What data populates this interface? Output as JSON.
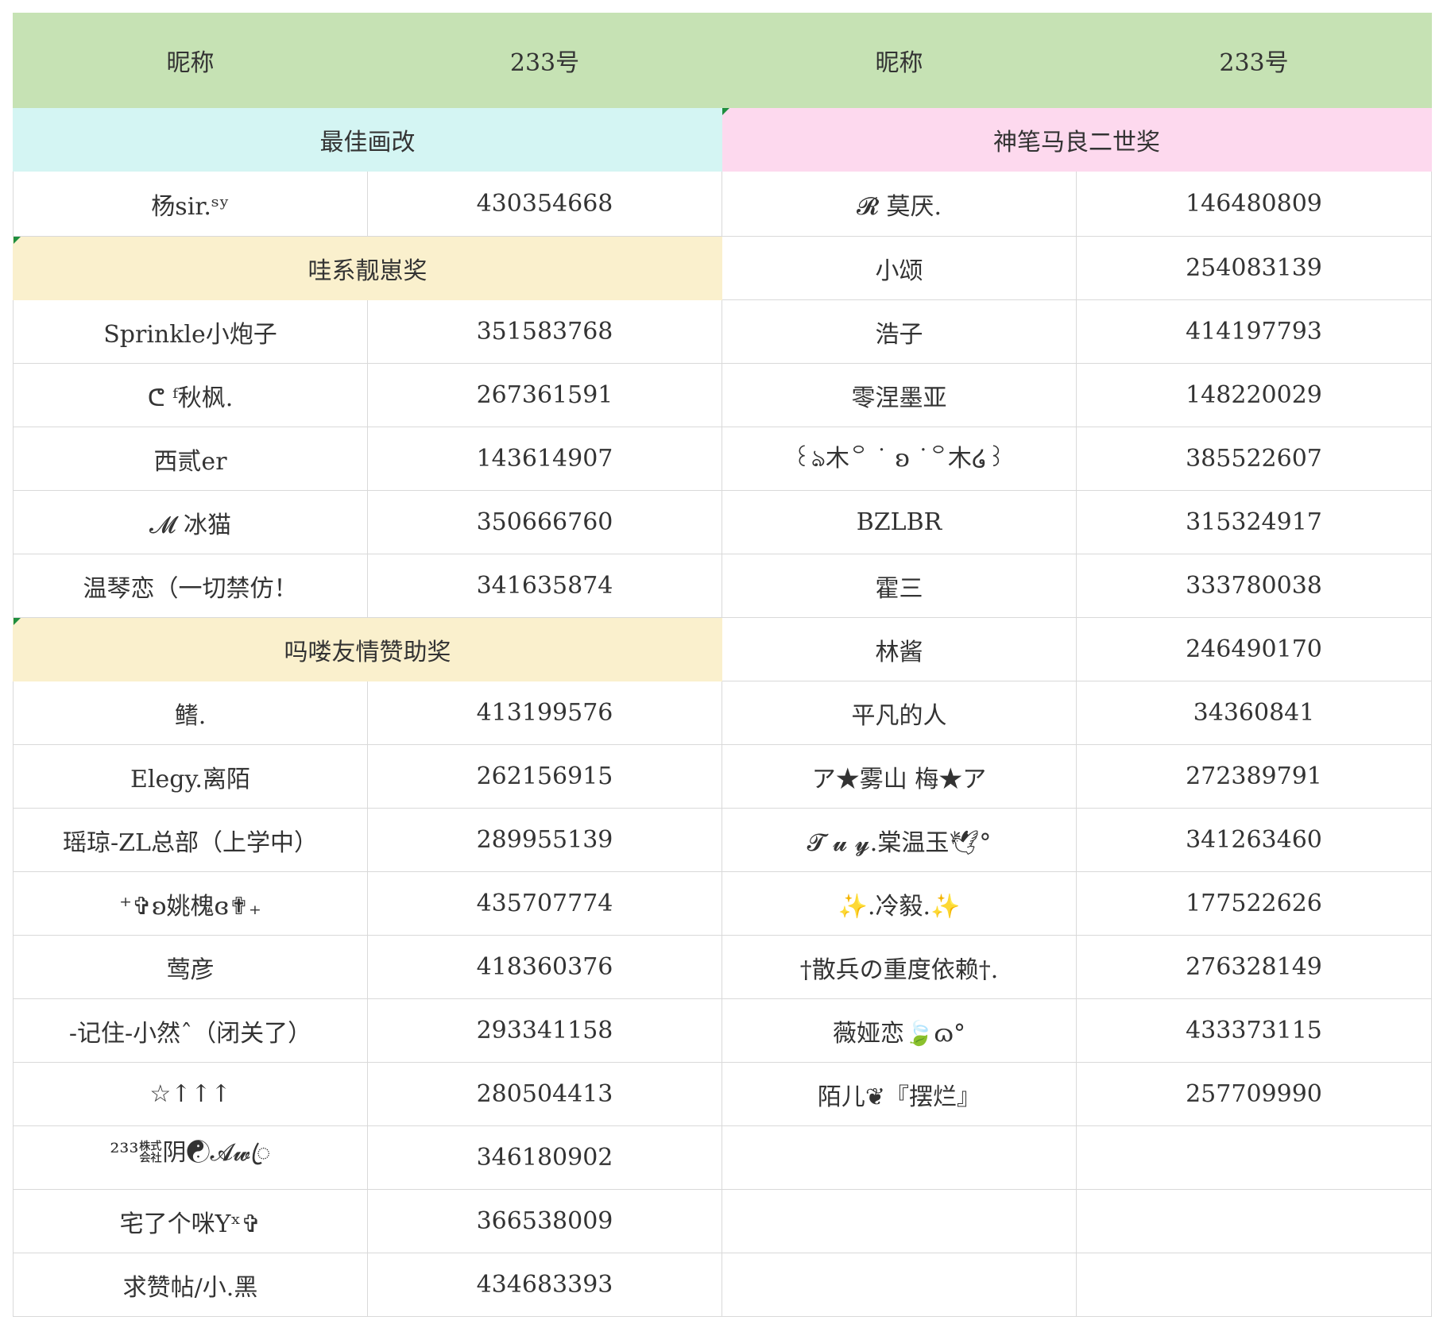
{
  "headers": [
    "昵称",
    "233号",
    "昵称",
    "233号"
  ],
  "awards": {
    "best_redraw": "最佳画改",
    "shenbi": "神笔马良二世奖",
    "wah_cute": "哇系靓崽奖",
    "malou_friendship": "吗喽友情赞助奖"
  },
  "left": [
    {
      "name": "杨sir.ˢʸ",
      "id": "430354668"
    },
    {
      "name": "Sprinkle小炮子",
      "id": "351583768"
    },
    {
      "name": "ᕦ ᶠ秋枫.",
      "id": "267361591"
    },
    {
      "name": "西贰er",
      "id": "143614907"
    },
    {
      "name": "𝓜 冰猫",
      "id": "350666760"
    },
    {
      "name": "温琴恋（一切禁仿！",
      "id": "341635874"
    },
    {
      "name": "鳍.",
      "id": "413199576"
    },
    {
      "name": "Elegy.离陌",
      "id": "262156915"
    },
    {
      "name": "瑶琼-ZL总部（上学中）",
      "id": "289955139"
    },
    {
      "name": "⁺✞ʚ姚槐ɞ✟₊",
      "id": "435707774"
    },
    {
      "name": "莺彦",
      "id": "418360376"
    },
    {
      "name": "-记住-小然ˆ（闭关了）",
      "id": "293341158"
    },
    {
      "name": "☆↑↑↑",
      "id": "280504413"
    },
    {
      "name": "²³³㍿阴☯𝓐𝔀ꦿ",
      "id": "346180902"
    },
    {
      "name": "宅了个咪Yˣ✞",
      "id": "366538009"
    },
    {
      "name": "求赞帖/小.黑",
      "id": "434683393"
    }
  ],
  "right": [
    {
      "name": "𝓡 莫厌.",
      "id": "146480809"
    },
    {
      "name": "小颂",
      "id": "254083139"
    },
    {
      "name": "浩子",
      "id": "414197793"
    },
    {
      "name": "零涅墨亚",
      "id": "148220029"
    },
    {
      "name": "꒰ঌ木꒪ ˙ ʚ ˙꒪木໒꒱",
      "id": "385522607"
    },
    {
      "name": "BZLBR",
      "id": "315324917"
    },
    {
      "name": "霍三",
      "id": "333780038"
    },
    {
      "name": "林酱",
      "id": "246490170"
    },
    {
      "name": "平凡的人",
      "id": "34360841"
    },
    {
      "name": "ア★雾山 梅★ア",
      "id": "272389791"
    },
    {
      "name": "𝓣 𝓾 𝔂.棠温玉🕊°",
      "id": "341263460"
    },
    {
      "name": "✨.冷毅.✨",
      "id": "177522626"
    },
    {
      "name": "†散兵の重度依赖†.",
      "id": "276328149"
    },
    {
      "name": "薇娅恋🍃ɷ°",
      "id": "433373115"
    },
    {
      "name": "陌儿❦『摆烂』",
      "id": "257709990"
    }
  ],
  "colors": {
    "header_bg": "#c6e2b4",
    "cyan_bg": "#d4f5f3",
    "pink_bg": "#fdd9ee",
    "yellow_bg": "#faf0cd",
    "flag": "#1e8e3e"
  }
}
